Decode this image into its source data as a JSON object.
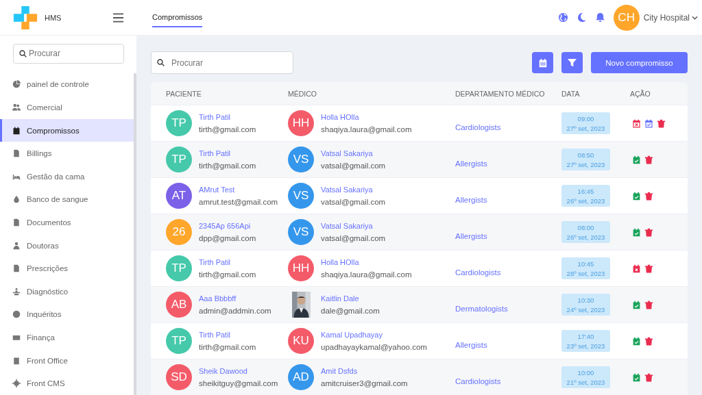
{
  "brand": {
    "name": "HMS"
  },
  "header": {
    "tabs": [
      {
        "label": "Compromissos",
        "selected": true
      }
    ],
    "user": {
      "initials": "CH",
      "name": "City Hospital"
    }
  },
  "sidebar": {
    "search": {
      "placeholder": "Procurar"
    },
    "items": [
      {
        "label": "painel de controle",
        "selected": false
      },
      {
        "label": "Comercial",
        "selected": false
      },
      {
        "label": "Compromissos",
        "selected": true
      },
      {
        "label": "Billings",
        "selected": false
      },
      {
        "label": "Gestão da cama",
        "selected": false
      },
      {
        "label": "Banco de sangue",
        "selected": false
      },
      {
        "label": "Documentos",
        "selected": false
      },
      {
        "label": "Doutoras",
        "selected": false
      },
      {
        "label": "Prescrições",
        "selected": false
      },
      {
        "label": "Diagnóstico",
        "selected": false
      },
      {
        "label": "Inquéritos",
        "selected": false
      },
      {
        "label": "Finança",
        "selected": false
      },
      {
        "label": "Front Office",
        "selected": false
      },
      {
        "label": "Front CMS",
        "selected": false
      }
    ]
  },
  "toolbar": {
    "search": {
      "placeholder": "Procurar"
    },
    "new_button": "Novo compromisso"
  },
  "table": {
    "columns": [
      "PACIENTE",
      "MÉDICO",
      "DEPARTAMENTO MÉDICO",
      "DATA",
      "AÇÃO"
    ],
    "rows": [
      {
        "patient": {
          "initials": "TP",
          "color": "#45c9aa",
          "name": "Tirth Patil",
          "email": "tirth@gmail.com"
        },
        "doctor": {
          "kind": "initials",
          "initials": "HH",
          "color": "#f45b69",
          "name": "Holla HOlla",
          "email": "shaqiya.laura@gmail.com"
        },
        "department": "Cardiologists",
        "time": "09:00",
        "date": "27º set, 2023",
        "actions": [
          {
            "kind": "cancel"
          },
          {
            "kind": "confirm"
          },
          {
            "kind": "delete"
          }
        ]
      },
      {
        "patient": {
          "initials": "TP",
          "color": "#45c9aa",
          "name": "Tirth Patil",
          "email": "tirth@gmail.com"
        },
        "doctor": {
          "kind": "initials",
          "initials": "VS",
          "color": "#3597ec",
          "name": "Vatsal Sakariya",
          "email": "vatsal@gmail.com"
        },
        "department": "Allergists",
        "time": "08:50",
        "date": "27º set, 2023",
        "actions": [
          {
            "kind": "completed"
          },
          {
            "kind": "delete"
          }
        ]
      },
      {
        "patient": {
          "initials": "AT",
          "color": "#7b61e8",
          "name": "AMrut Test",
          "email": "amrut.test@gmail.com"
        },
        "doctor": {
          "kind": "initials",
          "initials": "VS",
          "color": "#3597ec",
          "name": "Vatsal Sakariya",
          "email": "vatsal@gmail.com"
        },
        "department": "Allergists",
        "time": "16:45",
        "date": "26º set, 2023",
        "actions": [
          {
            "kind": "completed"
          },
          {
            "kind": "delete"
          }
        ]
      },
      {
        "patient": {
          "initials": "26",
          "color": "#ffa62b",
          "name": "2345Ap 656Api",
          "email": "dpp@gmail.com"
        },
        "doctor": {
          "kind": "initials",
          "initials": "VS",
          "color": "#3597ec",
          "name": "Vatsal Sakariya",
          "email": "vatsal@gmail.com"
        },
        "department": "Allergists",
        "time": "08:00",
        "date": "26º set, 2023",
        "actions": [
          {
            "kind": "completed"
          },
          {
            "kind": "delete"
          }
        ]
      },
      {
        "patient": {
          "initials": "TP",
          "color": "#45c9aa",
          "name": "Tirth Patil",
          "email": "tirth@gmail.com"
        },
        "doctor": {
          "kind": "initials",
          "initials": "HH",
          "color": "#f45b69",
          "name": "Holla HOlla",
          "email": "shaqiya.laura@gmail.com"
        },
        "department": "Cardiologists",
        "time": "10:45",
        "date": "28º set, 2023",
        "actions": [
          {
            "kind": "cancelled"
          },
          {
            "kind": "delete"
          }
        ]
      },
      {
        "patient": {
          "initials": "AB",
          "color": "#f45b69",
          "name": "Aaa Bbbbff",
          "email": "admin@addmin.com"
        },
        "doctor": {
          "kind": "picture",
          "name": "Kaitlin Dale",
          "email": "dale@gmail.com"
        },
        "department": "Dermatologists",
        "time": "10:30",
        "date": "24º set, 2023",
        "actions": [
          {
            "kind": "completed"
          },
          {
            "kind": "delete"
          }
        ]
      },
      {
        "patient": {
          "initials": "TP",
          "color": "#45c9aa",
          "name": "Tirth Patil",
          "email": "tirth@gmail.com"
        },
        "doctor": {
          "kind": "initials",
          "initials": "KU",
          "color": "#f45b69",
          "name": "Kamal Upadhayay",
          "email": "upadhayaykamal@yahoo.com"
        },
        "department": "Allergists",
        "time": "17:40",
        "date": "23º set, 2023",
        "actions": [
          {
            "kind": "completed"
          },
          {
            "kind": "delete"
          }
        ]
      },
      {
        "patient": {
          "initials": "SD",
          "color": "#f45b69",
          "name": "Sheik Dawood",
          "email": "sheikitguy@gmail.com"
        },
        "doctor": {
          "kind": "initials",
          "initials": "AD",
          "color": "#3597ec",
          "name": "Amit Dsfds",
          "email": "amitcruiser3@gmail.com"
        },
        "department": "Cardiologists",
        "time": "10:00",
        "date": "21º set, 2023",
        "actions": [
          {
            "kind": "completed"
          },
          {
            "kind": "delete"
          }
        ]
      }
    ]
  }
}
